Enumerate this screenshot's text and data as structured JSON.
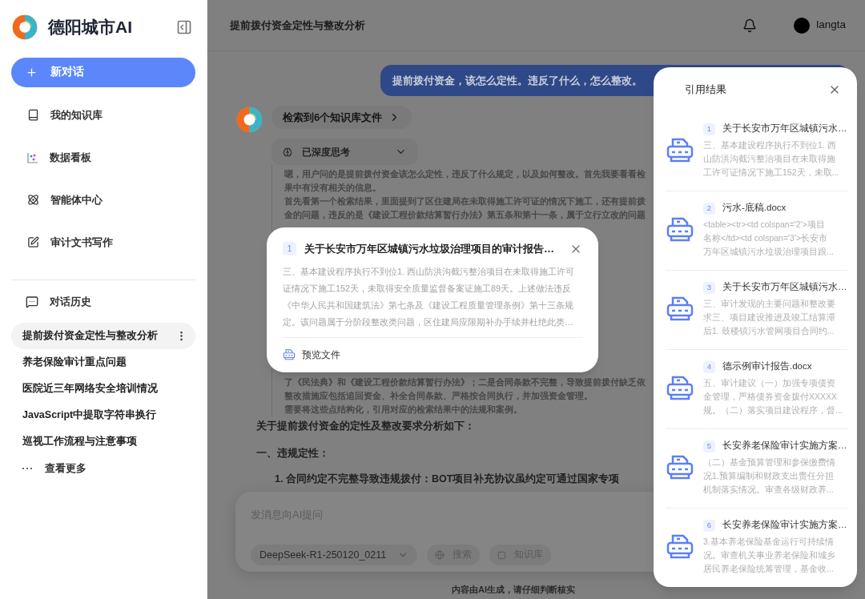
{
  "sidebar": {
    "brand": "德阳城市AI",
    "new_chat": "新对话",
    "nav": [
      {
        "label": "我的知识库"
      },
      {
        "label": "数据看板"
      },
      {
        "label": "智能体中心"
      },
      {
        "label": "审计文书写作"
      }
    ],
    "history_title": "对话历史",
    "history": [
      {
        "title": "提前拨付资金定性与整改分析",
        "selected": true
      },
      {
        "title": "养老保险审计重点问题",
        "selected": false
      },
      {
        "title": "医院近三年网络安全培训情况",
        "selected": false
      },
      {
        "title": "JavaScript中提取字符串换行",
        "selected": false
      },
      {
        "title": "巡视工作流程与注意事项",
        "selected": false
      }
    ],
    "more": "查看更多"
  },
  "header": {
    "title": "提前拨付资金定性与整改分析",
    "user": "langta"
  },
  "chat": {
    "user_message": "提前拨付资金，该怎么定性。违反了什么，怎么整改。",
    "sources_chip": "检索到6个知识库文件",
    "thinking_label": "已深度思考",
    "reasoning_top": [
      "嗯，用户问的是提前拨付资金该怎么定性，违反了什么规定，以及如何整改。首先我要看看检",
      "果中有没有相关的信息。",
      "首先看第一个检索结果，里面提到了区住建局在未取得施工许可证的情况下施工，还有提前拨",
      "金的问题，违反的是《建设工程价款结算暂行办法》第五条和第十一条，属于立行立改的问题"
    ],
    "reasoning_bottom": [
      "了《民法典》和《建设工程价款结算暂行办法》；二是合同条款不完整，导致提前拨付缺乏依",
      "整改措施应包括追回资金、补全合同条款、严格按合同执行，并加强资金管理。",
      "需要将这些点结构化，引用对应的检索结果中的法规和案例。"
    ],
    "answer": [
      {
        "kind": "heading",
        "text": "关于提前拨付资金的定性及整改要求分析如下："
      },
      {
        "kind": "section",
        "text": "一、违规定性："
      },
      {
        "kind": "item",
        "text": "1. 合同约定不完整导致违规拨付：BOT项目补充协议虽约定可通过国家专项"
      }
    ]
  },
  "composer": {
    "placeholder": "发消息向AI提问",
    "model": "DeepSeek-R1-250120_0211",
    "tools": [
      {
        "label": "搜索"
      },
      {
        "label": "知识库"
      }
    ]
  },
  "footer_note": "内容由AI生成，请仔细判断核实",
  "citation_popup": {
    "index": "1",
    "title": "关于长安市万年区城镇污水垃圾治理项目的审计报告…",
    "snippet_lines": [
      "三、基本建设程序执行不到位1. 西山防洪沟截污整治项目在未取得施工许可",
      "证情况下施工152天，未取得安全质量监督备案证施工89天。上述做法违反",
      "《中华人民共和国建筑法》第七条及《建设工程质量管理条例》第十三条规",
      "定。该问题属于分阶段整改类问题，区住建局应限期补办手续并杜绝此类…"
    ],
    "action": "预览文件"
  },
  "references": {
    "title": "引用结果",
    "items": [
      {
        "index": "1",
        "title": "关于长安市万年区城镇污水…",
        "snippet_lines": [
          "三、基本建设程序执行不到位1. 西",
          "山防洪沟截污整治项目在未取得施",
          "工许可证情况下施工152天，未取..."
        ]
      },
      {
        "index": "2",
        "title": "污水-底稿.docx",
        "snippet_lines": [
          "<table><tr><td colspan='2'>项目",
          "名称</td><td colspan='3'>长安市",
          "万年区城镇污水垃圾治理项目跟..."
        ]
      },
      {
        "index": "3",
        "title": "关于长安市万年区城镇污水…",
        "snippet_lines": [
          "三、审计发现的主要问题和整改要",
          "求三、项目建设推进及竣工结算滞",
          "后1. 鼓楼镇污水管网项目合同约..."
        ]
      },
      {
        "index": "4",
        "title": "德示例审计报告.docx",
        "snippet_lines": [
          "五、审计建议（一）加强专项债资",
          "金管理，严格债券资金拨付XXXXX",
          "规。（二）落实项目建设程序，督..."
        ]
      },
      {
        "index": "5",
        "title": "长安养老保险审计实施方案…",
        "snippet_lines": [
          "（二）基金预算管理和参保缴费情",
          "况1.预算编制和财政支出责任分担",
          "机制落实情况。审查各级财政养..."
        ]
      },
      {
        "index": "6",
        "title": "长安养老保险审计实施方案…",
        "snippet_lines": [
          "3.基本养老保险基金运行可持续情",
          "况。审查机关事业养老保险和城乡",
          "居民养老保险统筹管理，基金收..."
        ]
      }
    ]
  }
}
